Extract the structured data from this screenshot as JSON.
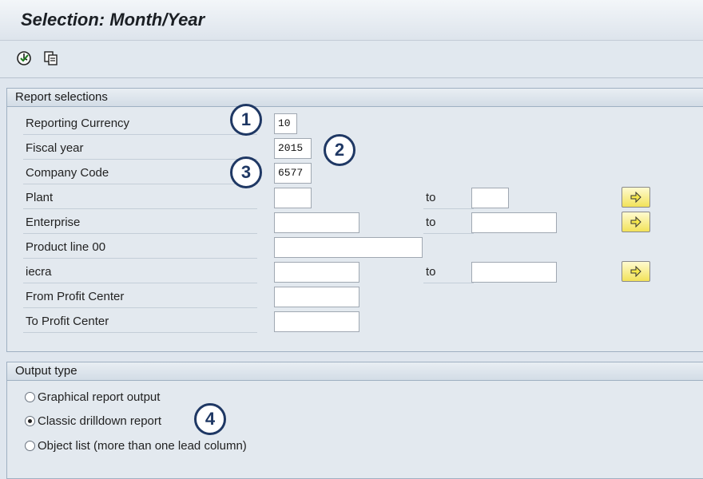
{
  "window": {
    "title": "Selection: Month/Year"
  },
  "toolbar": {
    "execute_icon": "execute-icon",
    "variants_icon": "get-variant-icon"
  },
  "report_selections": {
    "header": "Report selections",
    "to_label": "to",
    "fields": {
      "reporting_currency": {
        "label": "Reporting Currency",
        "value": "10"
      },
      "fiscal_year": {
        "label": "Fiscal year",
        "value": "2015"
      },
      "company_code": {
        "label": "Company Code",
        "value": "6577"
      },
      "plant": {
        "label": "Plant",
        "from": "",
        "to": ""
      },
      "enterprise": {
        "label": "Enterprise",
        "from": "",
        "to": ""
      },
      "product_line": {
        "label": "Product line 00",
        "value": ""
      },
      "iecra": {
        "label": "iecra",
        "from": "",
        "to": ""
      },
      "from_profit_center": {
        "label": "From Profit Center",
        "value": ""
      },
      "to_profit_center": {
        "label": "To Profit Center",
        "value": ""
      }
    }
  },
  "output_type": {
    "header": "Output type",
    "options": [
      {
        "label": "Graphical report output",
        "selected": false
      },
      {
        "label": "Classic drilldown report",
        "selected": true
      },
      {
        "label": "Object list (more than one lead column)",
        "selected": false
      }
    ]
  },
  "callouts": [
    "1",
    "2",
    "3",
    "4"
  ],
  "colors": {
    "callout": "#1f3864",
    "multi_button": "#f2e25a",
    "background": "#dfe6ee"
  }
}
